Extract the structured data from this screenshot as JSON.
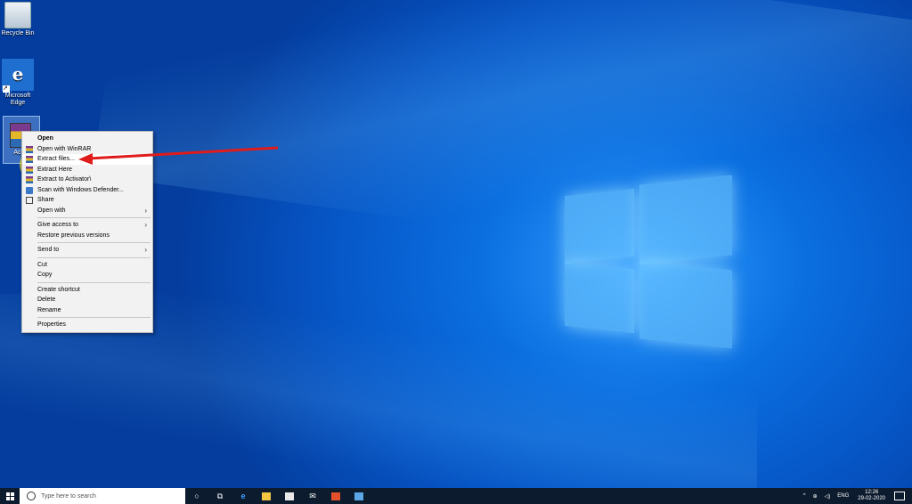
{
  "desktop": {
    "icons": [
      {
        "label": "Recycle Bin",
        "icon": "recycle-bin-icon"
      },
      {
        "label": "Microsoft Edge",
        "icon": "edge-icon"
      },
      {
        "label": "Activ",
        "icon": "winrar-archive-icon"
      }
    ]
  },
  "context_menu": {
    "items": [
      {
        "label": "Open",
        "bold": true
      },
      {
        "label": "Open with WinRAR",
        "icon": "winrar-icon"
      },
      {
        "label": "Extract files...",
        "icon": "winrar-icon",
        "highlighted": true
      },
      {
        "label": "Extract Here",
        "icon": "winrar-icon"
      },
      {
        "label": "Extract to Activator\\",
        "icon": "winrar-icon"
      },
      {
        "label": "Scan with Windows Defender...",
        "icon": "defender-icon"
      },
      {
        "label": "Share",
        "icon": "share-icon"
      },
      {
        "label": "Open with",
        "submenu": true
      },
      {
        "label": "Give access to",
        "submenu": true
      },
      {
        "label": "Restore previous versions"
      },
      {
        "label": "Send to",
        "submenu": true
      },
      {
        "label": "Cut"
      },
      {
        "label": "Copy"
      },
      {
        "label": "Create shortcut"
      },
      {
        "label": "Delete"
      },
      {
        "label": "Rename"
      },
      {
        "label": "Properties"
      }
    ]
  },
  "taskbar": {
    "search_placeholder": "Type here to search",
    "apps": [
      "cortana-icon",
      "task-view-icon",
      "edge-icon",
      "file-explorer-icon",
      "store-icon",
      "mail-icon",
      "office-icon",
      "photos-icon"
    ],
    "tray": {
      "language": "ENG",
      "time": "12:26",
      "date": "29-02-2020"
    }
  },
  "colors": {
    "accent_red": "#e01b1b",
    "desktop_blue": "#0b6fe0",
    "taskbar": "#0d1b2e"
  }
}
